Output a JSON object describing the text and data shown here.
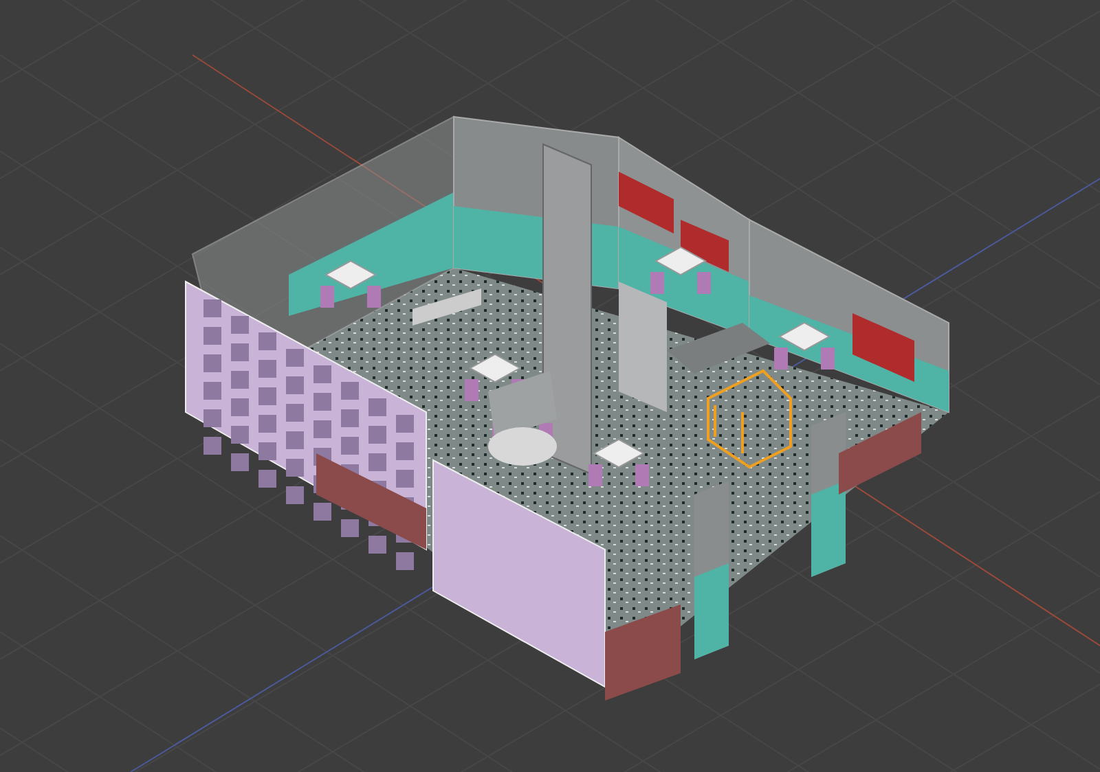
{
  "viewport": {
    "show_grid": true,
    "show_axes": true,
    "selection": true
  }
}
